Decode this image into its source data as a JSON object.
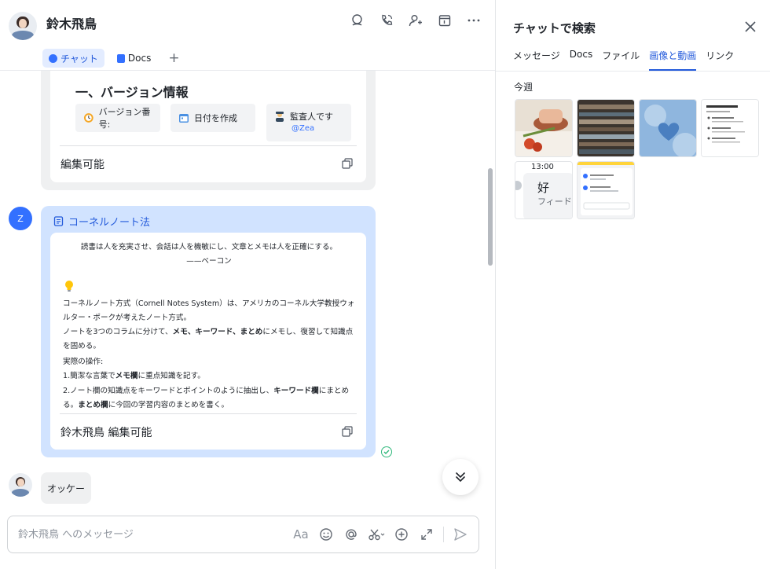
{
  "header": {
    "title": "鈴木飛鳥",
    "tabs": [
      {
        "label": "チャット"
      },
      {
        "label": "Docs"
      }
    ],
    "add_tab": "+"
  },
  "messages": {
    "version_card": {
      "heading": "一、バージョン情報",
      "field1": "バージョン番号:",
      "field2": "日付を作成",
      "field3": "監査人です",
      "field3_mention": "@Zea",
      "footer": "編集可能"
    },
    "note_card": {
      "sender_initial": "Z",
      "link_title": "コーネルノート法",
      "quote": "読書は人を充実させ、会話は人を機敏にし、文章とメモは人を正確にする。——ベーコン",
      "p1": "コーネルノート方式（Cornell Notes System）は、アメリカのコーネル大学教授ウォルター・ポークが考えたノート方式。",
      "p2_a": "ノートを3つのコラムに分けて、",
      "p2_b": "メモ、キーワード、まとめ",
      "p2_c": "にメモし、復習して知識点を固める。",
      "p3": "実際の操作:",
      "p4_a": "1.簡潔な言葉で",
      "p4_b": "メモ欄",
      "p4_c": "に重点知識を記す。",
      "p5_a": "2.ノート欄の知識点をキーワードとポイントのように抽出し、",
      "p5_b": "キーワード欄",
      "p5_c": "にまとめる。",
      "p6_a": "まとめ欄",
      "p6_b": "に今回の学習内容のまとめを書く。",
      "footer": "鈴木飛鳥 編集可能"
    },
    "reply": "オッケー"
  },
  "composer": {
    "placeholder": "鈴木飛鳥 へのメッセージ",
    "font_label": "Aa"
  },
  "panel": {
    "title": "チャットで検索",
    "tabs": [
      {
        "label": "メッセージ"
      },
      {
        "label": "Docs"
      },
      {
        "label": "ファイル"
      },
      {
        "label": "画像と動画"
      },
      {
        "label": "リンク"
      }
    ],
    "active_tab": "画像と動画",
    "section": "今週",
    "thumb_time": "13:00",
    "thumb_char": "好",
    "thumb_label": "フィードバック"
  },
  "colors": {
    "accent": "#245bdb",
    "note_card_bg": "#d1e3ff",
    "success": "#2db77a"
  }
}
